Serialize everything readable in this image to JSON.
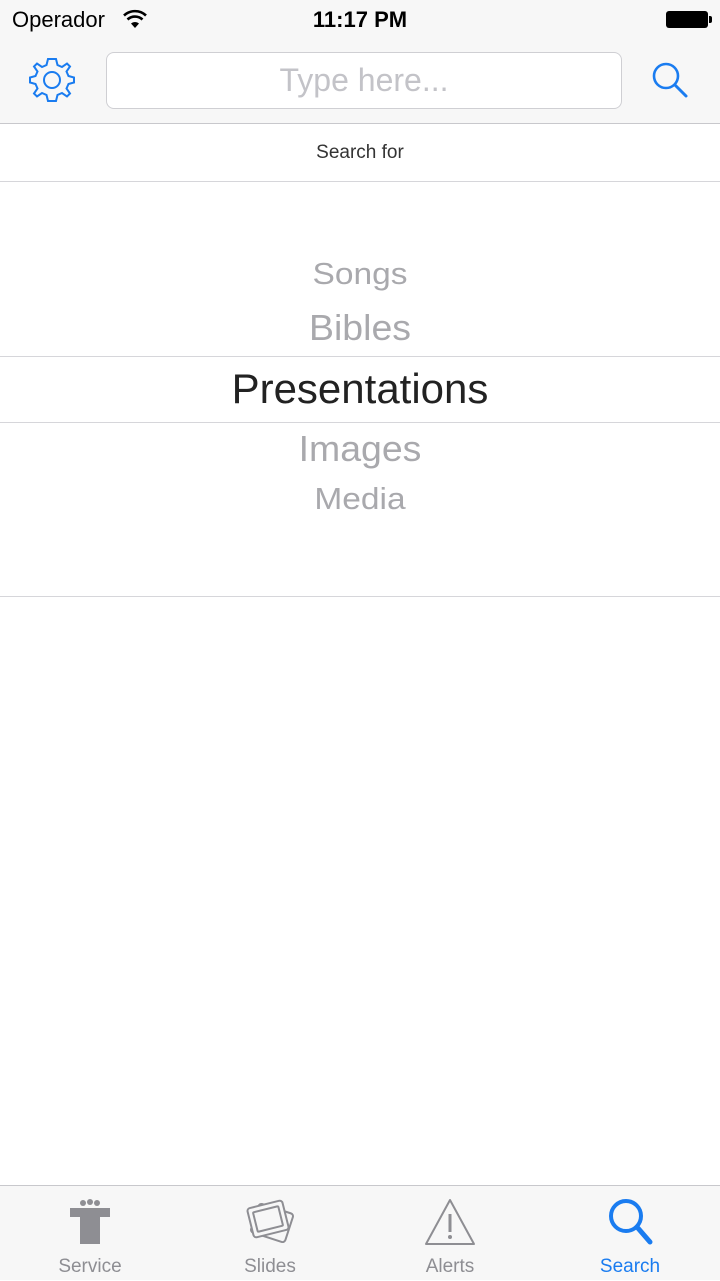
{
  "status_bar": {
    "carrier": "Operador",
    "time": "11:17 PM"
  },
  "header": {
    "settings_icon": "gear-icon",
    "search_placeholder": "Type here...",
    "search_icon": "search-icon",
    "accent_color": "#1a7cf0"
  },
  "section": {
    "label": "Search for"
  },
  "picker": {
    "options": [
      "Songs",
      "Bibles",
      "Presentations",
      "Images",
      "Media"
    ],
    "selected": "Presentations"
  },
  "tabbar": {
    "tabs": [
      {
        "label": "Service",
        "icon": "podium-icon"
      },
      {
        "label": "Slides",
        "icon": "slides-icon"
      },
      {
        "label": "Alerts",
        "icon": "warning-icon"
      },
      {
        "label": "Search",
        "icon": "search-icon"
      }
    ],
    "active": "Search"
  }
}
